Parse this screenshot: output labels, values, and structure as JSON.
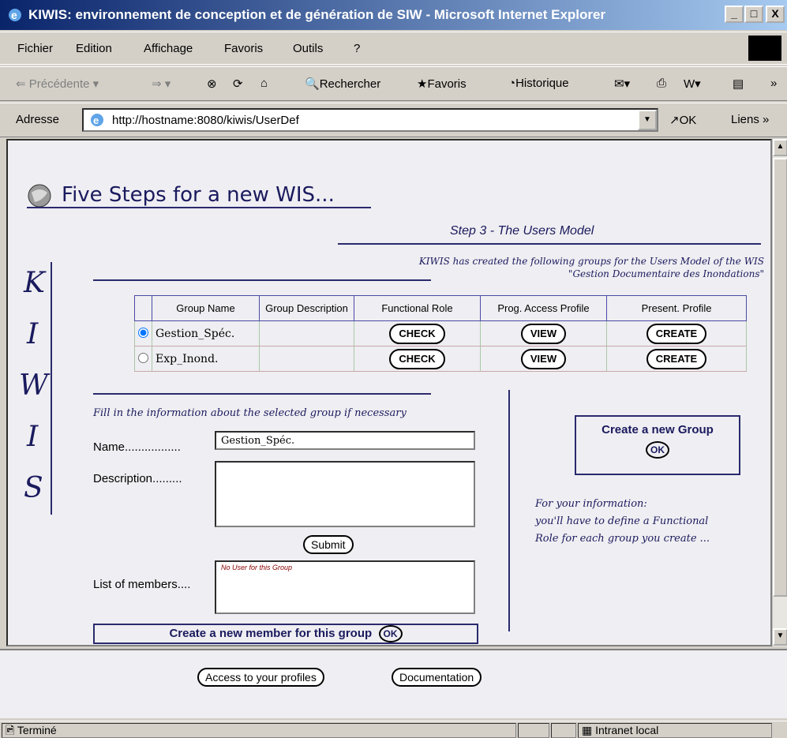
{
  "window": {
    "title": "KIWIS: environnement de conception et de génération de SIW - Microsoft Internet Explorer",
    "minimize": "_",
    "maximize": "□",
    "close": "X"
  },
  "menu": {
    "items": [
      "Fichier",
      "Edition",
      "Affichage",
      "Favoris",
      "Outils",
      "?"
    ]
  },
  "toolbar": {
    "back": "Précédente",
    "search": "Rechercher",
    "favorites": "Favoris",
    "history": "Historique"
  },
  "address": {
    "label": "Adresse",
    "url": "http://hostname:8080/kiwis/UserDef",
    "go": "OK",
    "links": "Liens"
  },
  "page": {
    "heading": "Five Steps for a new WIS...",
    "step_title": "Step 3 - The Users Model",
    "intro_line1": "KIWIS has created the following groups for the Users Model of the WIS",
    "intro_line2": "\"Gestion Documentaire des Inondations\"",
    "kiwis_letters": [
      "K",
      "I",
      "W",
      "I",
      "S"
    ],
    "table": {
      "headers": [
        "Group Name",
        "Group Description",
        "Functional Role",
        "Prog. Access Profile",
        "Present. Profile"
      ],
      "rows": [
        {
          "name": "Gestion_Spéc.",
          "description": "",
          "role": "CHECK",
          "access": "VIEW",
          "present": "CREATE",
          "selected": true
        },
        {
          "name": "Exp_Inond.",
          "description": "",
          "role": "CHECK",
          "access": "VIEW",
          "present": "CREATE",
          "selected": false
        }
      ]
    },
    "form": {
      "instruction": "Fill in the information about the selected group if necessary",
      "name_label": "Name.................",
      "name_value": "Gestion_Spéc.",
      "description_label": "Description.........",
      "description_value": "",
      "submit": "Submit",
      "members_label": "List of members....",
      "members_value": "No User for this Group",
      "create_member": "Create a new member for this group",
      "ok": "OK"
    },
    "new_group": {
      "title": "Create a new Group",
      "ok": "OK"
    },
    "info": {
      "line1": "For your information:",
      "line2": "you'll have to define a Functional",
      "line3": "Role for each group you create ..."
    },
    "footer": {
      "profiles": "Access to your profiles",
      "documentation": "Documentation"
    }
  },
  "status": {
    "text": "Terminé",
    "zone": "Intranet local"
  }
}
